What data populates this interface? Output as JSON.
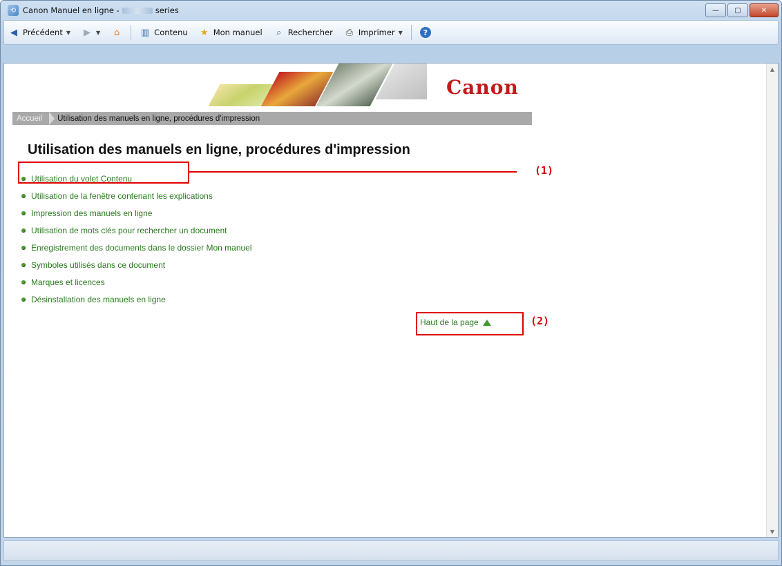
{
  "window": {
    "title_prefix": "Canon Manuel en ligne -",
    "title_suffix": "series",
    "minimize": "—",
    "maximize": "▢",
    "close": "✕"
  },
  "toolbar": {
    "back_label": "Précédent",
    "contents_label": "Contenu",
    "my_manual_label": "Mon manuel",
    "search_label": "Rechercher",
    "print_label": "Imprimer"
  },
  "banner": {
    "logo_text": "Canon",
    "colors": {
      "logo": "#c41a1a",
      "breadcrumb_bg": "#a9a9a9"
    }
  },
  "breadcrumb": {
    "home": "Accueil",
    "current": "Utilisation des manuels en ligne, procédures d'impression"
  },
  "main": {
    "title": "Utilisation des manuels en ligne, procédures d'impression",
    "links": [
      "Utilisation du volet Contenu",
      "Utilisation de la fenêtre contenant les explications",
      "Impression des manuels en ligne",
      "Utilisation de mots clés pour rechercher un document",
      "Enregistrement des documents dans le dossier Mon manuel",
      "Symboles utilisés dans ce document",
      "Marques et licences",
      "Désinstallation des manuels en ligne"
    ],
    "top_link": "Haut de la page",
    "link_color": "#2a7a1f"
  },
  "callouts": [
    "(1)",
    "(2)"
  ]
}
